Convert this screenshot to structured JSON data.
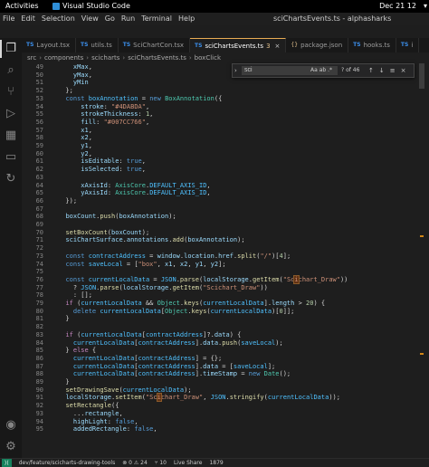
{
  "system_bar": {
    "activities": "Activities",
    "app_name": "Visual Studio Code",
    "clock": "Dec 21  12"
  },
  "window": {
    "menus": [
      "File",
      "Edit",
      "Selection",
      "View",
      "Go",
      "Run",
      "Terminal",
      "Help"
    ],
    "title": "sciChartsEvents.ts - alphasharks"
  },
  "tabs": [
    {
      "type": "TS",
      "label": "Layout.tsx",
      "active": false
    },
    {
      "type": "TS",
      "label": "utils.ts",
      "active": false
    },
    {
      "type": "TS",
      "label": "SciChartCon.tsx",
      "active": false
    },
    {
      "type": "TS",
      "label": "sciChartsEvents.ts",
      "active": true,
      "extra": "3"
    },
    {
      "type": "{}",
      "label": "package.json",
      "active": false
    },
    {
      "type": "TS",
      "label": "hooks.ts",
      "active": false
    },
    {
      "type": "TS",
      "label": "i",
      "active": false
    }
  ],
  "breadcrumb": [
    "src",
    "components",
    "scicharts",
    "sciChartsEvents.ts",
    "boxClick"
  ],
  "find_widget": {
    "query": "sci",
    "options": "Aa  ab  .*",
    "count": "? of 46",
    "buttons": [
      "↑",
      "↓",
      "≡",
      "×"
    ]
  },
  "code_lines": [
    {
      "n": "49",
      "tokens": [
        [
          "p",
          "    "
        ],
        [
          "var",
          "xMax"
        ],
        [
          "p",
          ","
        ]
      ]
    },
    {
      "n": "50",
      "tokens": [
        [
          "p",
          "    "
        ],
        [
          "var",
          "yMax"
        ],
        [
          "p",
          ","
        ]
      ]
    },
    {
      "n": "51",
      "tokens": [
        [
          "p",
          "    "
        ],
        [
          "var",
          "yMin"
        ]
      ]
    },
    {
      "n": "52",
      "tokens": [
        [
          "p",
          "  };"
        ]
      ]
    },
    {
      "n": "53",
      "tokens": [
        [
          "p",
          "  "
        ],
        [
          "kw",
          "const"
        ],
        [
          "p",
          " "
        ],
        [
          "cst",
          "boxAnnotation"
        ],
        [
          "p",
          " = "
        ],
        [
          "kw",
          "new"
        ],
        [
          "p",
          " "
        ],
        [
          "cls",
          "BoxAnnotation"
        ],
        [
          "p",
          "({"
        ]
      ]
    },
    {
      "n": "54",
      "tokens": [
        [
          "p",
          "      "
        ],
        [
          "var",
          "stroke"
        ],
        [
          "p",
          ": "
        ],
        [
          "str",
          "\"#4DABDA\""
        ],
        [
          "p",
          ","
        ]
      ]
    },
    {
      "n": "55",
      "tokens": [
        [
          "p",
          "      "
        ],
        [
          "var",
          "strokeThickness"
        ],
        [
          "p",
          ": "
        ],
        [
          "num",
          "1"
        ],
        [
          "p",
          ","
        ]
      ]
    },
    {
      "n": "56",
      "tokens": [
        [
          "p",
          "      "
        ],
        [
          "var",
          "fill"
        ],
        [
          "p",
          ": "
        ],
        [
          "str",
          "\"#007CC766\""
        ],
        [
          "p",
          ","
        ]
      ]
    },
    {
      "n": "57",
      "tokens": [
        [
          "p",
          "      "
        ],
        [
          "var",
          "x1"
        ],
        [
          "p",
          ","
        ]
      ]
    },
    {
      "n": "58",
      "tokens": [
        [
          "p",
          "      "
        ],
        [
          "var",
          "x2"
        ],
        [
          "p",
          ","
        ]
      ]
    },
    {
      "n": "59",
      "tokens": [
        [
          "p",
          "      "
        ],
        [
          "var",
          "y1"
        ],
        [
          "p",
          ","
        ]
      ]
    },
    {
      "n": "60",
      "tokens": [
        [
          "p",
          "      "
        ],
        [
          "var",
          "y2"
        ],
        [
          "p",
          ","
        ]
      ]
    },
    {
      "n": "61",
      "tokens": [
        [
          "p",
          "      "
        ],
        [
          "var",
          "isEditable"
        ],
        [
          "p",
          ": "
        ],
        [
          "kw",
          "true"
        ],
        [
          "p",
          ","
        ]
      ]
    },
    {
      "n": "62",
      "tokens": [
        [
          "p",
          "      "
        ],
        [
          "var",
          "isSelected"
        ],
        [
          "p",
          ": "
        ],
        [
          "kw",
          "true"
        ],
        [
          "p",
          ","
        ]
      ]
    },
    {
      "n": "63",
      "tokens": [
        [
          "p",
          ""
        ]
      ]
    },
    {
      "n": "64",
      "tokens": [
        [
          "p",
          "      "
        ],
        [
          "var",
          "xAxisId"
        ],
        [
          "p",
          ": "
        ],
        [
          "cls",
          "AxisCore"
        ],
        [
          "p",
          "."
        ],
        [
          "cst",
          "DEFAULT_AXIS_ID"
        ],
        [
          "p",
          ","
        ]
      ]
    },
    {
      "n": "65",
      "tokens": [
        [
          "p",
          "      "
        ],
        [
          "var",
          "yAxisId"
        ],
        [
          "p",
          ": "
        ],
        [
          "cls",
          "AxisCore"
        ],
        [
          "p",
          "."
        ],
        [
          "cst",
          "DEFAULT_AXIS_ID"
        ],
        [
          "p",
          ","
        ]
      ]
    },
    {
      "n": "66",
      "tokens": [
        [
          "p",
          "  });"
        ]
      ]
    },
    {
      "n": "67",
      "tokens": [
        [
          "p",
          ""
        ]
      ]
    },
    {
      "n": "68",
      "tokens": [
        [
          "p",
          "  "
        ],
        [
          "var",
          "boxCount"
        ],
        [
          "p",
          "."
        ],
        [
          "fn",
          "push"
        ],
        [
          "p",
          "("
        ],
        [
          "var",
          "boxAnnotation"
        ],
        [
          "p",
          ");"
        ]
      ]
    },
    {
      "n": "69",
      "tokens": [
        [
          "p",
          ""
        ]
      ]
    },
    {
      "n": "70",
      "tokens": [
        [
          "p",
          "  "
        ],
        [
          "fn",
          "setBoxCount"
        ],
        [
          "p",
          "("
        ],
        [
          "var",
          "boxCount"
        ],
        [
          "p",
          ");"
        ]
      ]
    },
    {
      "n": "71",
      "tokens": [
        [
          "p",
          "  "
        ],
        [
          "var",
          "sciChartSurface"
        ],
        [
          "p",
          "."
        ],
        [
          "var",
          "annotations"
        ],
        [
          "p",
          "."
        ],
        [
          "fn",
          "add"
        ],
        [
          "p",
          "("
        ],
        [
          "var",
          "boxAnnotation"
        ],
        [
          "p",
          ");"
        ]
      ]
    },
    {
      "n": "72",
      "tokens": [
        [
          "p",
          ""
        ]
      ]
    },
    {
      "n": "73",
      "tokens": [
        [
          "p",
          "  "
        ],
        [
          "kw",
          "const"
        ],
        [
          "p",
          " "
        ],
        [
          "cst",
          "contractAddress"
        ],
        [
          "p",
          " = "
        ],
        [
          "var",
          "window"
        ],
        [
          "p",
          "."
        ],
        [
          "var",
          "location"
        ],
        [
          "p",
          "."
        ],
        [
          "var",
          "href"
        ],
        [
          "p",
          "."
        ],
        [
          "fn",
          "split"
        ],
        [
          "p",
          "("
        ],
        [
          "str",
          "\"/\""
        ],
        [
          "p",
          ")["
        ],
        [
          "num",
          "4"
        ],
        [
          "p",
          "];"
        ]
      ]
    },
    {
      "n": "74",
      "tokens": [
        [
          "p",
          "  "
        ],
        [
          "kw",
          "const"
        ],
        [
          "p",
          " "
        ],
        [
          "cst",
          "saveLocal"
        ],
        [
          "p",
          " = ["
        ],
        [
          "str",
          "\"box\""
        ],
        [
          "p",
          ", "
        ],
        [
          "var",
          "x1"
        ],
        [
          "p",
          ", "
        ],
        [
          "var",
          "x2"
        ],
        [
          "p",
          ", "
        ],
        [
          "var",
          "y1"
        ],
        [
          "p",
          ", "
        ],
        [
          "var",
          "y2"
        ],
        [
          "p",
          "];"
        ]
      ]
    },
    {
      "n": "75",
      "tokens": [
        [
          "p",
          ""
        ]
      ]
    },
    {
      "n": "76",
      "tokens": [
        [
          "p",
          "  "
        ],
        [
          "kw",
          "const"
        ],
        [
          "p",
          " "
        ],
        [
          "cst",
          "currentLocalData"
        ],
        [
          "p",
          " = "
        ],
        [
          "cst",
          "JSON"
        ],
        [
          "p",
          "."
        ],
        [
          "fn",
          "parse"
        ],
        [
          "p",
          "("
        ],
        [
          "var",
          "localStorage"
        ],
        [
          "p",
          "."
        ],
        [
          "fn",
          "getItem"
        ],
        [
          "p",
          "("
        ],
        [
          "str",
          "\"Sc"
        ],
        [
          "hl",
          "i"
        ],
        [
          "str",
          "chart_Draw\""
        ],
        [
          "p",
          "))"
        ]
      ]
    },
    {
      "n": "77",
      "tokens": [
        [
          "p",
          "    ? "
        ],
        [
          "cst",
          "JSON"
        ],
        [
          "p",
          "."
        ],
        [
          "fn",
          "parse"
        ],
        [
          "p",
          "("
        ],
        [
          "var",
          "localStorage"
        ],
        [
          "p",
          "."
        ],
        [
          "fn",
          "getItem"
        ],
        [
          "p",
          "("
        ],
        [
          "str",
          "\"Scichart_Draw\""
        ],
        [
          "p",
          "))"
        ]
      ]
    },
    {
      "n": "78",
      "tokens": [
        [
          "p",
          "    : [];"
        ]
      ]
    },
    {
      "n": "79",
      "tokens": [
        [
          "p",
          "  "
        ],
        [
          "ctl",
          "if"
        ],
        [
          "p",
          " ("
        ],
        [
          "cst",
          "currentLocalData"
        ],
        [
          "p",
          " && "
        ],
        [
          "cls",
          "Object"
        ],
        [
          "p",
          "."
        ],
        [
          "fn",
          "keys"
        ],
        [
          "p",
          "("
        ],
        [
          "cst",
          "currentLocalData"
        ],
        [
          "p",
          "]."
        ],
        [
          "var",
          "length"
        ],
        [
          "p",
          " > "
        ],
        [
          "num",
          "20"
        ],
        [
          "p",
          ") {"
        ]
      ]
    },
    {
      "n": "80",
      "tokens": [
        [
          "p",
          "    "
        ],
        [
          "kw",
          "delete"
        ],
        [
          "p",
          " "
        ],
        [
          "cst",
          "currentLocalData"
        ],
        [
          "p",
          "["
        ],
        [
          "cls",
          "Object"
        ],
        [
          "p",
          "."
        ],
        [
          "fn",
          "keys"
        ],
        [
          "p",
          "("
        ],
        [
          "cst",
          "currentLocalData"
        ],
        [
          "p",
          ")["
        ],
        [
          "num",
          "0"
        ],
        [
          "p",
          "]];"
        ]
      ]
    },
    {
      "n": "81",
      "tokens": [
        [
          "p",
          "  }"
        ]
      ]
    },
    {
      "n": "82",
      "tokens": [
        [
          "p",
          ""
        ]
      ]
    },
    {
      "n": "83",
      "tokens": [
        [
          "p",
          "  "
        ],
        [
          "ctl",
          "if"
        ],
        [
          "p",
          " ("
        ],
        [
          "cst",
          "currentLocalData"
        ],
        [
          "p",
          "["
        ],
        [
          "cst",
          "contractAddress"
        ],
        [
          "p",
          "]?."
        ],
        [
          "var",
          "data"
        ],
        [
          "p",
          ") {"
        ]
      ]
    },
    {
      "n": "84",
      "tokens": [
        [
          "p",
          "    "
        ],
        [
          "cst",
          "currentLocalData"
        ],
        [
          "p",
          "["
        ],
        [
          "cst",
          "contractAddress"
        ],
        [
          "p",
          "]."
        ],
        [
          "var",
          "data"
        ],
        [
          "p",
          "."
        ],
        [
          "fn",
          "push"
        ],
        [
          "p",
          "("
        ],
        [
          "cst",
          "saveLocal"
        ],
        [
          "p",
          ");"
        ]
      ]
    },
    {
      "n": "85",
      "tokens": [
        [
          "p",
          "  } "
        ],
        [
          "ctl",
          "else"
        ],
        [
          "p",
          " {"
        ]
      ]
    },
    {
      "n": "86",
      "tokens": [
        [
          "p",
          "    "
        ],
        [
          "cst",
          "currentLocalData"
        ],
        [
          "p",
          "["
        ],
        [
          "cst",
          "contractAddress"
        ],
        [
          "p",
          "] = {};"
        ]
      ]
    },
    {
      "n": "87",
      "tokens": [
        [
          "p",
          "    "
        ],
        [
          "cst",
          "currentLocalData"
        ],
        [
          "p",
          "["
        ],
        [
          "cst",
          "contractAddress"
        ],
        [
          "p",
          "]."
        ],
        [
          "var",
          "data"
        ],
        [
          "p",
          " = ["
        ],
        [
          "cst",
          "saveLocal"
        ],
        [
          "p",
          "];"
        ]
      ]
    },
    {
      "n": "88",
      "tokens": [
        [
          "p",
          "    "
        ],
        [
          "cst",
          "currentLocalData"
        ],
        [
          "p",
          "["
        ],
        [
          "cst",
          "contractAddress"
        ],
        [
          "p",
          "]."
        ],
        [
          "var",
          "timeStamp"
        ],
        [
          "p",
          " = "
        ],
        [
          "kw",
          "new"
        ],
        [
          "p",
          " "
        ],
        [
          "cls",
          "Date"
        ],
        [
          "p",
          "();"
        ]
      ]
    },
    {
      "n": "89",
      "tokens": [
        [
          "p",
          "  }"
        ]
      ]
    },
    {
      "n": "90",
      "tokens": [
        [
          "p",
          "  "
        ],
        [
          "fn",
          "setDrawingSave"
        ],
        [
          "p",
          "("
        ],
        [
          "cst",
          "currentLocalData"
        ],
        [
          "p",
          ");"
        ]
      ]
    },
    {
      "n": "91",
      "tokens": [
        [
          "p",
          "  "
        ],
        [
          "var",
          "localStorage"
        ],
        [
          "p",
          "."
        ],
        [
          "fn",
          "setItem"
        ],
        [
          "p",
          "("
        ],
        [
          "str",
          "\"Sc"
        ],
        [
          "hl",
          "i"
        ],
        [
          "str",
          "chart_Draw\""
        ],
        [
          "p",
          ", "
        ],
        [
          "cst",
          "JSON"
        ],
        [
          "p",
          "."
        ],
        [
          "fn",
          "stringify"
        ],
        [
          "p",
          "("
        ],
        [
          "cst",
          "currentLocalData"
        ],
        [
          "p",
          "));"
        ]
      ]
    },
    {
      "n": "92",
      "tokens": [
        [
          "p",
          "  "
        ],
        [
          "fn",
          "setRectangle"
        ],
        [
          "p",
          "({"
        ]
      ]
    },
    {
      "n": "93",
      "tokens": [
        [
          "p",
          "    ..."
        ],
        [
          "var",
          "rectangle"
        ],
        [
          "p",
          ","
        ]
      ]
    },
    {
      "n": "94",
      "tokens": [
        [
          "p",
          "    "
        ],
        [
          "var",
          "highLight"
        ],
        [
          "p",
          ": "
        ],
        [
          "kw",
          "false"
        ],
        [
          "p",
          ","
        ]
      ]
    },
    {
      "n": "95",
      "tokens": [
        [
          "p",
          "    "
        ],
        [
          "var",
          "addedRectangle"
        ],
        [
          "p",
          ": "
        ],
        [
          "kw",
          "false"
        ],
        [
          "p",
          ","
        ]
      ]
    }
  ],
  "status_bar": {
    "branch": "dev/feature/scicharts-drawing-tools",
    "errors": "⊗ 0  ⚠ 24",
    "ports": "⑂ 10",
    "live_share": "Live Share",
    "position": "1879"
  },
  "colors": {
    "active_tab_border": "#e8ab53",
    "find_match": "#613214",
    "keyword": "#569cd6",
    "string": "#ce9178",
    "function": "#dcdcaa",
    "type": "#4ec9b0"
  }
}
